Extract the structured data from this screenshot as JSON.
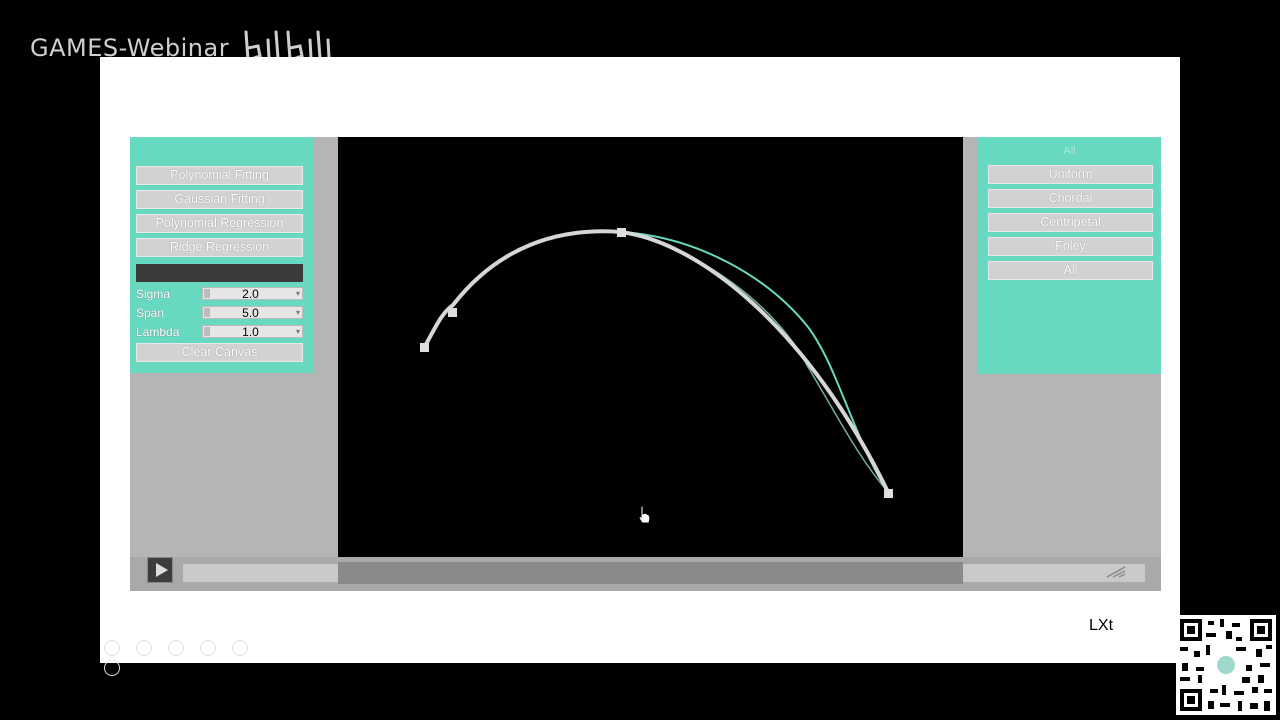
{
  "watermark": {
    "text": "GAMES-Webinar"
  },
  "left_panel": {
    "buttons": [
      {
        "label": "Polynomial Fitting"
      },
      {
        "label": "Gaussian Fitting"
      },
      {
        "label": "Polynomial Regression"
      },
      {
        "label": "Ridge Regression"
      }
    ],
    "params": [
      {
        "label": "Sigma",
        "value": "2.0"
      },
      {
        "label": "Span",
        "value": "5.0"
      },
      {
        "label": "Lambda",
        "value": "1.0"
      }
    ],
    "clear_label": "Clear Canvas"
  },
  "right_panel": {
    "title": "All",
    "buttons": [
      {
        "label": "Uniform"
      },
      {
        "label": "Chordal"
      },
      {
        "label": "Centripetal"
      },
      {
        "label": "Foley"
      },
      {
        "label": "All"
      }
    ]
  },
  "author": {
    "text": "LXt"
  },
  "colors": {
    "panel": "#66d9c0",
    "button": "#d2d2d2",
    "curve_main": "#d6d6d6",
    "curve_accent": "#66d9c0",
    "canvas": "#000000"
  }
}
